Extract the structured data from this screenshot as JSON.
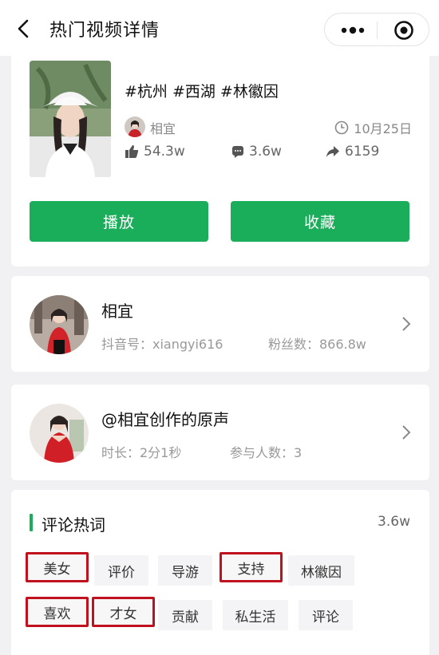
{
  "nav": {
    "title": "热门视频详情",
    "icons": [
      "back-arrow-icon",
      "more-dots-icon",
      "target-icon"
    ]
  },
  "video": {
    "hashtags": "#杭州 #西湖 #林徽因",
    "author": "相宜",
    "date": "10月25日",
    "likes": "54.3w",
    "comments": "3.6w",
    "shares": "6159",
    "play_label": "播放",
    "collect_label": "收藏"
  },
  "user": {
    "name": "相宜",
    "douyin_id": "抖音号：xiangyi616",
    "fans": "粉丝数：866.8w"
  },
  "music": {
    "title": "@相宜创作的原声",
    "duration": "时长：2分1秒",
    "participants": "参与人数：3"
  },
  "hot_words": {
    "title": "评论热词",
    "count": "3.6w",
    "words": [
      {
        "label": "美女",
        "highlighted": true
      },
      {
        "label": "评价",
        "highlighted": false
      },
      {
        "label": "导游",
        "highlighted": false
      },
      {
        "label": "支持",
        "highlighted": true
      },
      {
        "label": "林徽因",
        "highlighted": false
      },
      {
        "label": "喜欢",
        "highlighted": true
      },
      {
        "label": "才女",
        "highlighted": true
      },
      {
        "label": "贡献",
        "highlighted": false
      },
      {
        "label": "私生活",
        "highlighted": false
      },
      {
        "label": "评论",
        "highlighted": false
      }
    ]
  },
  "colors": {
    "accent": "#1aad5a",
    "highlight_border": "#c0121e"
  }
}
